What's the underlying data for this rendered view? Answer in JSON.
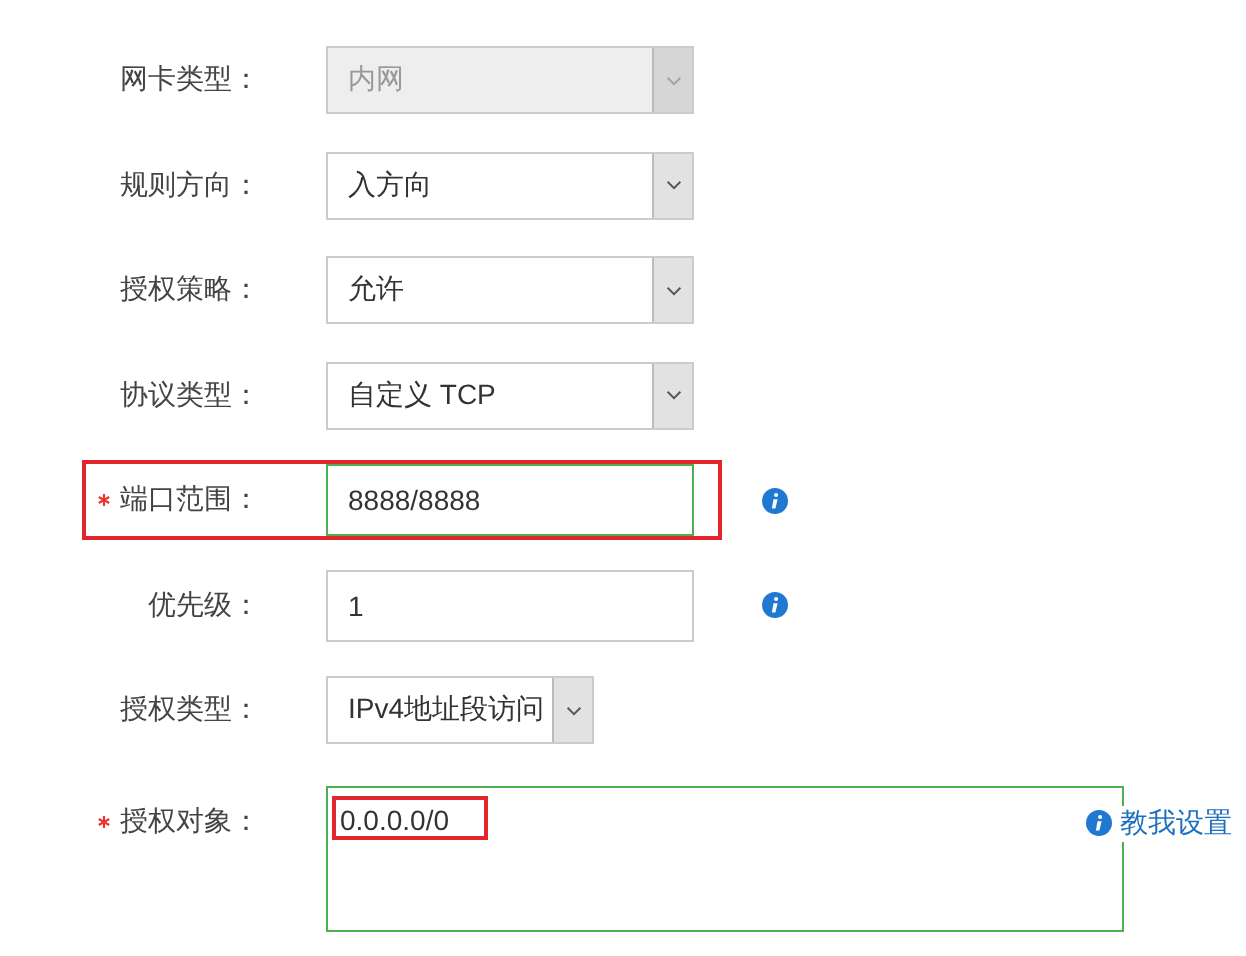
{
  "form": {
    "rows": [
      {
        "kind": "select",
        "label": "网卡类型：",
        "required": false,
        "value": "内网",
        "disabled": true,
        "info": false,
        "highlighted": false
      },
      {
        "kind": "select",
        "label": "规则方向：",
        "required": false,
        "value": "入方向",
        "disabled": false,
        "info": false,
        "highlighted": false
      },
      {
        "kind": "select",
        "label": "授权策略：",
        "required": false,
        "value": "允许",
        "disabled": false,
        "info": false,
        "highlighted": false
      },
      {
        "kind": "select",
        "label": "协议类型：",
        "required": false,
        "value": "自定义 TCP",
        "disabled": false,
        "info": false,
        "highlighted": false
      },
      {
        "kind": "input",
        "label": "端口范围：",
        "required": true,
        "value": "8888/8888",
        "valid": true,
        "info": true,
        "highlighted": true
      },
      {
        "kind": "input",
        "label": "优先级：",
        "required": false,
        "value": "1",
        "valid": false,
        "info": true,
        "highlighted": false
      },
      {
        "kind": "short-select",
        "label": "授权类型：",
        "required": false,
        "value": "IPv4地址段访问",
        "disabled": false,
        "info": false,
        "highlighted": false
      },
      {
        "kind": "textarea",
        "label": "授权对象：",
        "required": true,
        "value": "0.0.0.0/0",
        "valid": true,
        "info": true,
        "highlighted": false,
        "value_highlighted": true,
        "help_link": "教我设置"
      }
    ]
  }
}
